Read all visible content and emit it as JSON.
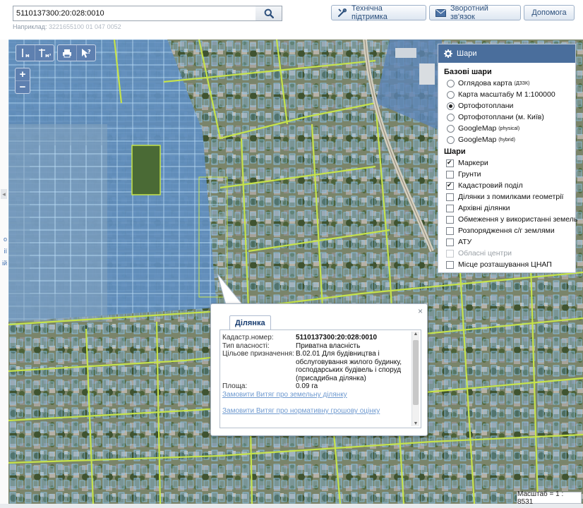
{
  "search": {
    "value": "5110137300:20:028:0010",
    "hint_label": "Наприклад:",
    "hint_example": "3221655100 01 047 0052"
  },
  "header": {
    "support_label": "Технічна підтримка",
    "feedback_label": "Зворотний зв'язок",
    "help_label": "Допомога"
  },
  "gutter_links": [
    "о",
    "ії",
    "ій"
  ],
  "gutter_arrow": "◂",
  "map_tools": {
    "zoom_in": "+",
    "zoom_out": "−"
  },
  "layers_panel": {
    "title": "Шари",
    "base_section": "Базові шари",
    "base_layers": [
      {
        "label": "Оглядова карта",
        "sup": "(ДЗЗК)",
        "selected": false
      },
      {
        "label": "Карта масштабу М 1:100000",
        "sup": "",
        "selected": false
      },
      {
        "label": "Ортофотоплани",
        "sup": "",
        "selected": true
      },
      {
        "label": "Ортофотоплани (м. Київ)",
        "sup": "",
        "selected": false
      },
      {
        "label": "GoogleMap",
        "sup": "(physical)",
        "selected": false
      },
      {
        "label": "GoogleMap",
        "sup": "(hybrid)",
        "selected": false
      }
    ],
    "overlay_section": "Шари",
    "overlays": [
      {
        "label": "Маркери",
        "checked": true,
        "disabled": false
      },
      {
        "label": "Грунти",
        "checked": false,
        "disabled": false
      },
      {
        "label": "Кадастровий поділ",
        "checked": true,
        "disabled": false
      },
      {
        "label": "Ділянки з помилками геометрії",
        "checked": false,
        "disabled": false
      },
      {
        "label": "Архівні ділянки",
        "checked": false,
        "disabled": false
      },
      {
        "label": "Обмеження у використанні земель",
        "checked": false,
        "disabled": false
      },
      {
        "label": "Розпорядження с/г землями",
        "checked": false,
        "disabled": false
      },
      {
        "label": "АТУ",
        "checked": false,
        "disabled": false
      },
      {
        "label": "Обласні центри",
        "checked": false,
        "disabled": true
      },
      {
        "label": "Місце розташування ЦНАП",
        "checked": false,
        "disabled": false
      }
    ]
  },
  "popup": {
    "close": "×",
    "tab_label": "Ділянка",
    "properties": [
      {
        "label": "Кадастр.номер:",
        "value": "5110137300:20:028:0010",
        "bold": true
      },
      {
        "label": "Тип власності:",
        "value": "Приватна власність",
        "bold": false
      },
      {
        "label": "Цільове призначення:",
        "value": "В.02.01 Для будівництва і обслуговування жилого будинку, господарських будівель і споруд (присадибна ділянка)",
        "bold": false
      },
      {
        "label": "Площа:",
        "value": "0.09 га",
        "bold": false
      }
    ],
    "link_extract": "Замовити Витяг про земельну ділянку",
    "link_valuation": "Замовити Витяг про нормативну грошову оцінку",
    "scroll_up": "▲",
    "scroll_down": "▼"
  },
  "scale_text": "Масштаб = 1 : 8531",
  "colors": {
    "accent": "#4a6e9c",
    "parcel_outline": "#8ec9f3",
    "road": "#c6e34a",
    "link": "#6f9ad0"
  }
}
